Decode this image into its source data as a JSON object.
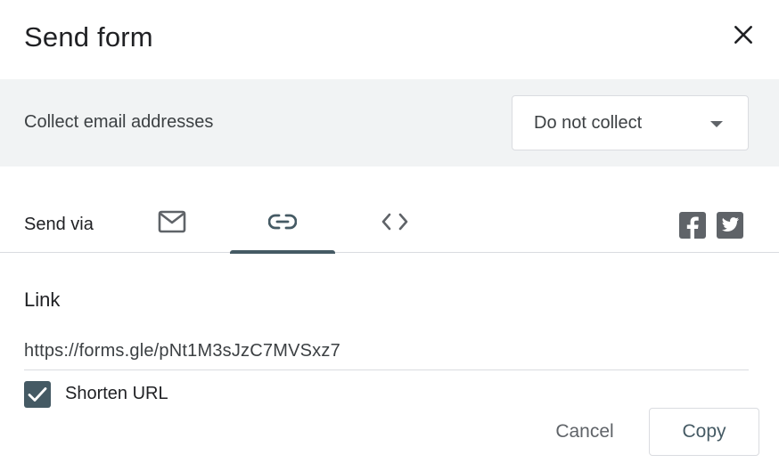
{
  "dialog": {
    "title": "Send form",
    "close_icon": "close-icon"
  },
  "collect": {
    "label": "Collect email addresses",
    "selected": "Do not collect",
    "arrow_icon": "dropdown-arrow-icon"
  },
  "send_via": {
    "label": "Send via",
    "tabs": [
      {
        "icon": "email-icon",
        "active": false
      },
      {
        "icon": "link-icon",
        "active": true
      },
      {
        "icon": "embed-code-icon",
        "active": false
      }
    ],
    "social": [
      {
        "icon": "facebook-icon"
      },
      {
        "icon": "twitter-icon"
      }
    ],
    "accent_color": "#455a64"
  },
  "link": {
    "heading": "Link",
    "url": "https://forms.gle/pNt1M3sJzC7MVSxz7",
    "shorten_label": "Shorten URL",
    "shorten_checked": true
  },
  "actions": {
    "cancel_label": "Cancel",
    "copy_label": "Copy"
  }
}
